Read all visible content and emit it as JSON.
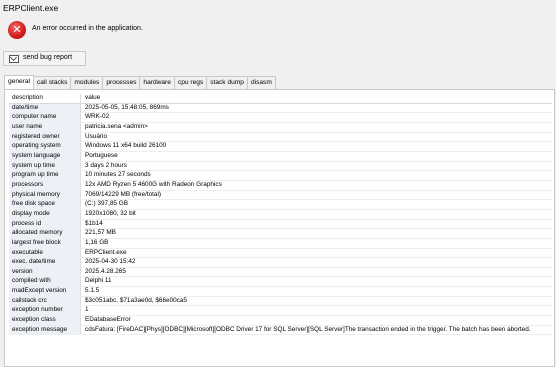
{
  "window": {
    "title": "ERPClient.exe"
  },
  "error": {
    "message": "An error occurred in the application."
  },
  "actions": {
    "send_bug_report": "send bug report"
  },
  "tabs": [
    "general",
    "call stacks",
    "modules",
    "processes",
    "hardware",
    "cpu regs",
    "stack dump",
    "disasm"
  ],
  "grid": {
    "header": {
      "key": "description",
      "value": "value"
    },
    "rows": [
      {
        "key": "date/time",
        "value": "2025-05-05, 15:48:05, 869ms"
      },
      {
        "key": "computer name",
        "value": "WRK-02"
      },
      {
        "key": "user name",
        "value": "patricia.sena  <admin>"
      },
      {
        "key": "registered owner",
        "value": "Usuário"
      },
      {
        "key": "operating system",
        "value": "Windows 11 x64 build 26100"
      },
      {
        "key": "system language",
        "value": "Portuguese"
      },
      {
        "key": "system up time",
        "value": "3 days 2 hours"
      },
      {
        "key": "program up time",
        "value": "10 minutes 27 seconds"
      },
      {
        "key": "processors",
        "value": "12x AMD Ryzen 5 4600G with Radeon Graphics"
      },
      {
        "key": "physical memory",
        "value": "7069/14229 MB (free/total)"
      },
      {
        "key": "free disk space",
        "value": "(C:) 397,85 GB"
      },
      {
        "key": "display mode",
        "value": "1920x1080, 32 bit"
      },
      {
        "key": "process id",
        "value": "$1b14"
      },
      {
        "key": "allocated memory",
        "value": "221,57 MB"
      },
      {
        "key": "largest free block",
        "value": "1,16 GB"
      },
      {
        "key": "executable",
        "value": "ERPClient.exe"
      },
      {
        "key": "exec. date/time",
        "value": "2025-04-30 15:42"
      },
      {
        "key": "version",
        "value": "2025.4.28.265"
      },
      {
        "key": "compiled with",
        "value": "Delphi 11"
      },
      {
        "key": "madExcept version",
        "value": "5.1.5"
      },
      {
        "key": "callstack crc",
        "value": "$3c051abc, $71a3ae0d, $66e00ca5"
      },
      {
        "key": "exception number",
        "value": "1"
      },
      {
        "key": "exception class",
        "value": "EDatabaseError"
      },
      {
        "key": "exception message",
        "value": "cdsFatura: [FireDAC][Phys][ODBC][Microsoft][ODBC Driver 17 for SQL Server][SQL Server]The transaction ended in the trigger. The batch has been aborted."
      }
    ]
  }
}
